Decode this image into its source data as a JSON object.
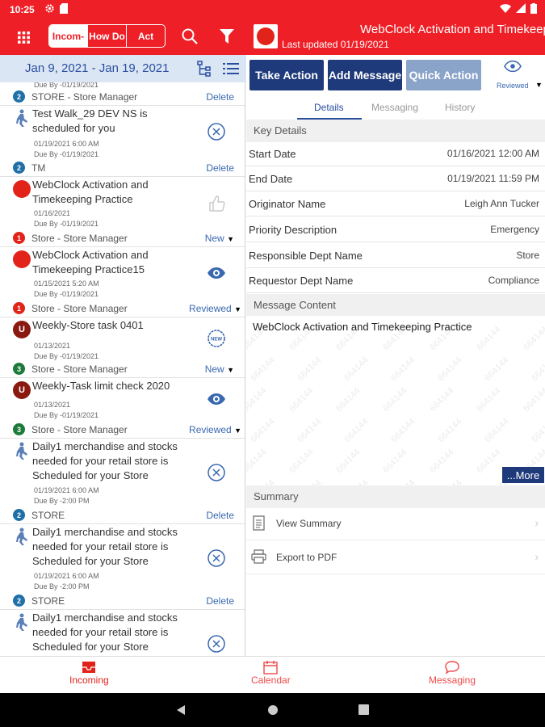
{
  "status_bar": {
    "time": "10:25"
  },
  "left_header": {
    "tabs": [
      "Incom-",
      "How Do",
      "Act"
    ]
  },
  "date_range": "Jan 9, 2021 - Jan 19, 2021",
  "list": {
    "top_partial": {
      "due": "Due By -01/19/2021",
      "badge": "2",
      "category": "STORE - Store Manager",
      "action": "Delete"
    },
    "items": [
      {
        "title": "Test Walk_29 DEV NS is scheduled for you",
        "date": "01/19/2021 6:00 AM",
        "due": "Due By -01/19/2021",
        "badge": "2",
        "category": "TM",
        "action": "Delete"
      },
      {
        "title": "WebClock Activation and Timekeeping Practice",
        "date": "01/16/2021",
        "due": "Due By -01/19/2021",
        "badge": "1",
        "category": "Store - Store Manager",
        "action": "New"
      },
      {
        "title": "WebClock Activation and Timekeeping Practice15",
        "date": "01/15/2021 5:20 AM",
        "due": "Due By -01/19/2021",
        "badge": "1",
        "category": "Store - Store Manager",
        "action": "Reviewed"
      },
      {
        "title": "Weekly-Store task 0401",
        "date": "01/13/2021",
        "due": "Due By -01/19/2021",
        "badge": "3",
        "category": "Store - Store Manager",
        "action": "New",
        "avatar": "U"
      },
      {
        "title": "Weekly-Task limit check 2020",
        "date": "01/13/2021",
        "due": "Due By -01/19/2021",
        "badge": "3",
        "category": "Store - Store Manager",
        "action": "Reviewed",
        "avatar": "U"
      },
      {
        "title": "Daily1 merchandise and stocks needed for your retail store is Scheduled for your Store",
        "date": "01/19/2021 6:00 AM",
        "due": "Due By -2:00 PM",
        "badge": "2",
        "category": "STORE",
        "action": "Delete"
      },
      {
        "title": "Daily1 merchandise and stocks needed for your retail store is Scheduled for your Store",
        "date": "01/19/2021 6:00 AM",
        "due": "Due By -2:00 PM",
        "badge": "2",
        "category": "STORE",
        "action": "Delete"
      },
      {
        "title": "Daily1 merchandise and stocks needed for your retail store is Scheduled for your Store"
      }
    ]
  },
  "right_header": {
    "title": "WebClock Activation and Timekeeping Practice",
    "last_updated": "Last updated 01/19/2021"
  },
  "actions": {
    "take_action": "Take Action",
    "add_message": "Add Message",
    "quick_action": "Quick Action",
    "reviewed": "Reviewed"
  },
  "detail_tabs": [
    "Details",
    "Messaging",
    "History"
  ],
  "key_details": {
    "heading": "Key Details",
    "rows": [
      {
        "label": "Start Date",
        "value": "01/16/2021 12:00 AM"
      },
      {
        "label": "End Date",
        "value": "01/19/2021 11:59 PM"
      },
      {
        "label": "Originator Name",
        "value": "Leigh Ann Tucker"
      },
      {
        "label": "Priority Description",
        "value": "Emergency"
      },
      {
        "label": "Responsible Dept Name",
        "value": "Store"
      },
      {
        "label": "Requestor Dept Name",
        "value": "Compliance"
      }
    ]
  },
  "message_content": {
    "heading": "Message Content",
    "text": "WebClock Activation and Timekeeping Practice",
    "watermark": "664144",
    "more": "...More"
  },
  "summary": {
    "heading": "Summary",
    "view": "View Summary",
    "export": "Export to PDF"
  },
  "bottom_nav": {
    "incoming": "Incoming",
    "calendar": "Calendar",
    "messaging": "Messaging"
  },
  "colors": {
    "brand_red": "#ee1f26",
    "navy": "#1f3a7a",
    "link_blue": "#3a68b0"
  }
}
